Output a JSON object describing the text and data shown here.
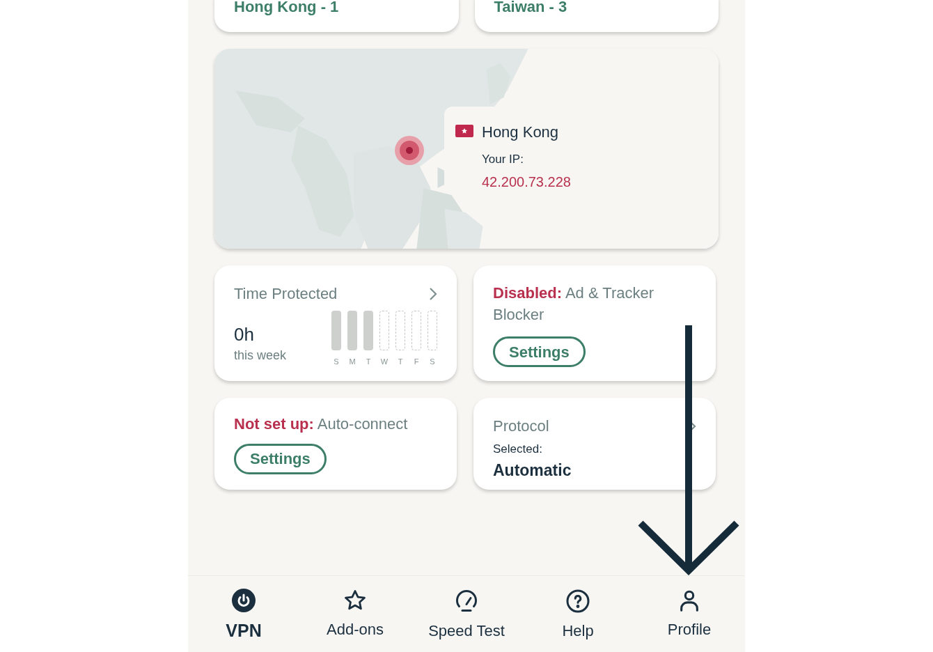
{
  "server_cards": [
    {
      "label": "Hong Kong - 1"
    },
    {
      "label": "Taiwan - 3"
    }
  ],
  "map": {
    "country": "Hong Kong",
    "ip_label": "Your IP:",
    "ip": "42.200.73.228"
  },
  "time_protected": {
    "title": "Time Protected",
    "value": "0h",
    "caption": "this week",
    "days": [
      {
        "label": "S",
        "filled": true
      },
      {
        "label": "M",
        "filled": true
      },
      {
        "label": "T",
        "filled": true
      },
      {
        "label": "W",
        "filled": false
      },
      {
        "label": "T",
        "filled": false
      },
      {
        "label": "F",
        "filled": false
      },
      {
        "label": "S",
        "filled": false
      }
    ]
  },
  "ad_blocker": {
    "status": "Disabled:",
    "feature": "Ad & Tracker Blocker",
    "button": "Settings"
  },
  "auto_connect": {
    "status": "Not set up:",
    "feature": "Auto-connect",
    "button": "Settings"
  },
  "protocol": {
    "title": "Protocol",
    "label": "Selected:",
    "value": "Automatic"
  },
  "nav": [
    {
      "label": "VPN",
      "kind": "power",
      "selected": true
    },
    {
      "label": "Add-ons",
      "kind": "star",
      "selected": false
    },
    {
      "label": "Speed Test",
      "kind": "gauge",
      "selected": false
    },
    {
      "label": "Help",
      "kind": "help",
      "selected": false
    },
    {
      "label": "Profile",
      "kind": "profile",
      "selected": false
    }
  ]
}
